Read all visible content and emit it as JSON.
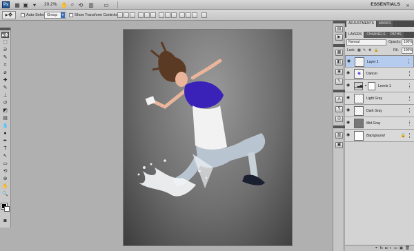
{
  "appbar": {
    "logo": "Ps",
    "zoom": "20.2%",
    "workspace": "ESSENTIALS"
  },
  "options": {
    "auto_select_label": "Auto-Select:",
    "auto_select_value": "Group",
    "show_transform_label": "Show Transform Controls"
  },
  "tools": [
    {
      "name": "move-tool",
      "glyph": "▸✥",
      "active": true
    },
    {
      "name": "marquee-tool",
      "glyph": "⬚"
    },
    {
      "name": "lasso-tool",
      "glyph": "ᘐ"
    },
    {
      "name": "quick-select-tool",
      "glyph": "✎"
    },
    {
      "name": "crop-tool",
      "glyph": "⌗"
    },
    {
      "name": "eyedropper-tool",
      "glyph": "⌀"
    },
    {
      "name": "healing-tool",
      "glyph": "✚"
    },
    {
      "name": "brush-tool",
      "glyph": "✎"
    },
    {
      "name": "stamp-tool",
      "glyph": "⊥"
    },
    {
      "name": "history-brush-tool",
      "glyph": "↺"
    },
    {
      "name": "eraser-tool",
      "glyph": "◩"
    },
    {
      "name": "gradient-tool",
      "glyph": "▤"
    },
    {
      "name": "blur-tool",
      "glyph": "💧"
    },
    {
      "name": "dodge-tool",
      "glyph": "●"
    },
    {
      "name": "pen-tool",
      "glyph": "✒"
    },
    {
      "name": "type-tool",
      "glyph": "T"
    },
    {
      "name": "path-select-tool",
      "glyph": "↖"
    },
    {
      "name": "shape-tool",
      "glyph": "▭"
    },
    {
      "name": "3d-rotate-tool",
      "glyph": "⟲"
    },
    {
      "name": "3d-camera-tool",
      "glyph": "⊛"
    },
    {
      "name": "hand-tool",
      "glyph": "✋"
    },
    {
      "name": "zoom-tool",
      "glyph": "🔍"
    }
  ],
  "panels": {
    "top_tabs": [
      "ADJUSTMENTS",
      "MASKS"
    ],
    "layer_tabs": [
      "LAYERS",
      "CHANNELS",
      "PATHS"
    ],
    "blend_mode": "Normal",
    "opacity_label": "Opacity:",
    "opacity_value": "100%",
    "lock_label": "Lock:",
    "fill_label": "Fill:",
    "fill_value": "100%",
    "layers": [
      {
        "name": "Layer 1",
        "selected": true,
        "thumb": "checker"
      },
      {
        "name": "Dancer",
        "thumb": "fig"
      },
      {
        "name": "Levels 1",
        "thumb": "adjust"
      },
      {
        "name": "Light Gray",
        "thumb": "checker"
      },
      {
        "name": "Dark Gray",
        "thumb": "checker"
      },
      {
        "name": "Mid Gray",
        "thumb": "dark"
      },
      {
        "name": "Background",
        "thumb": "white",
        "locked": true
      }
    ]
  }
}
